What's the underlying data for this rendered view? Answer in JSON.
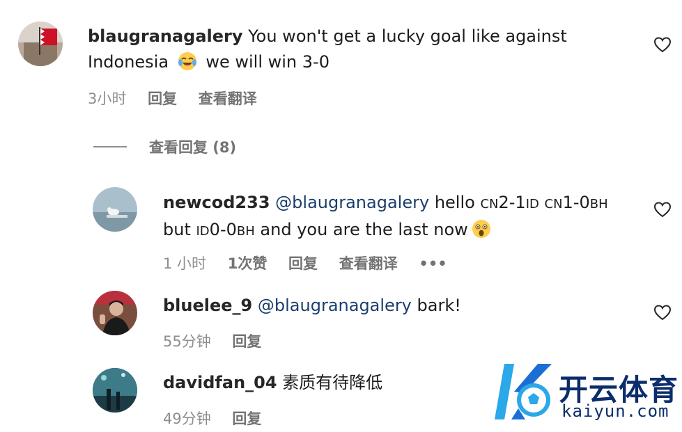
{
  "comments": [
    {
      "username": "blaugranagalery",
      "text_part1": "You won't get a lucky goal like against",
      "text_part2a": "Indonesia",
      "emoji": "laughing-tears-emoji",
      "text_part2b": "we will win 3-0",
      "time": "3小时",
      "reply_label": "回复",
      "translate_label": "查看翻译"
    }
  ],
  "view_replies": {
    "label": "查看回复 (8)"
  },
  "replies": [
    {
      "username": "newcod233",
      "mention": "@blaugranagalery",
      "text_a": "hello",
      "flag1": "CN",
      "score1": "2-1",
      "flag2": "ID",
      "flag3": "CN",
      "score2": "1-0",
      "flag4": "BH",
      "text_b": "but",
      "flag5": "ID",
      "score3": "0-0",
      "flag6": "BH",
      "text_c": "and you are the last now",
      "emoji": "shocked-face-emoji",
      "time": "1 小时",
      "likes": "1次赞",
      "reply_label": "回复",
      "translate_label": "查看翻译",
      "more_label": "•••"
    },
    {
      "username": "bluelee_9",
      "mention": "@blaugranagalery",
      "text": "bark!",
      "time": "55分钟",
      "reply_label": "回复"
    },
    {
      "username": "davidfan_04",
      "text": "素质有待降低",
      "time": "49分钟",
      "reply_label": "回复"
    }
  ],
  "watermark": {
    "name_cn": "开云体育",
    "domain": "kaiyun.com"
  },
  "colors": {
    "text": "#262626",
    "mention": "#1b3e6c",
    "meta": "#8e8e8e",
    "watermark": "#0c2d6b",
    "watermark_accent": "#2aa8e8"
  }
}
